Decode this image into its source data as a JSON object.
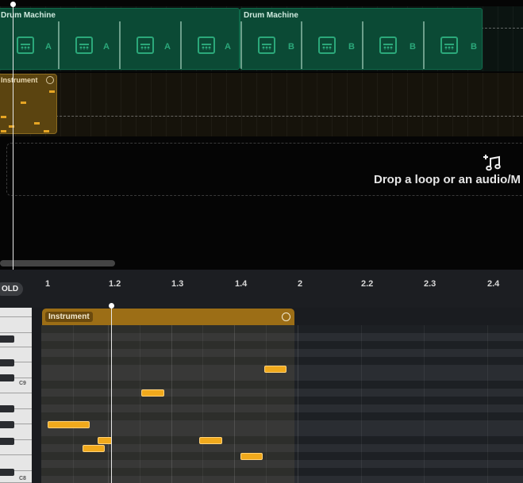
{
  "arrangement": {
    "drum_clips": [
      {
        "title": "Drum Machine",
        "patterns": [
          "A",
          "A",
          "A",
          "A"
        ]
      },
      {
        "title": "Drum Machine",
        "patterns": [
          "B",
          "B",
          "B",
          "B"
        ]
      }
    ],
    "instrument_clip_title": "Instrument",
    "drop_zone_text": "Drop a loop or an audio/M",
    "drop_icon": "add-music-note-icon"
  },
  "piano_roll": {
    "fold_label": "OLD",
    "ruler_ticks": [
      "1",
      "1.2",
      "1.3",
      "1.4",
      "2",
      "2.2",
      "2.3",
      "2.4"
    ],
    "clip_label": "Instrument",
    "key_labels": [
      "C9",
      "C8"
    ],
    "colors": {
      "accent": "#f0a91c",
      "drum_clip": "#0b4a35",
      "instrument_clip": "#9c6e16"
    }
  }
}
